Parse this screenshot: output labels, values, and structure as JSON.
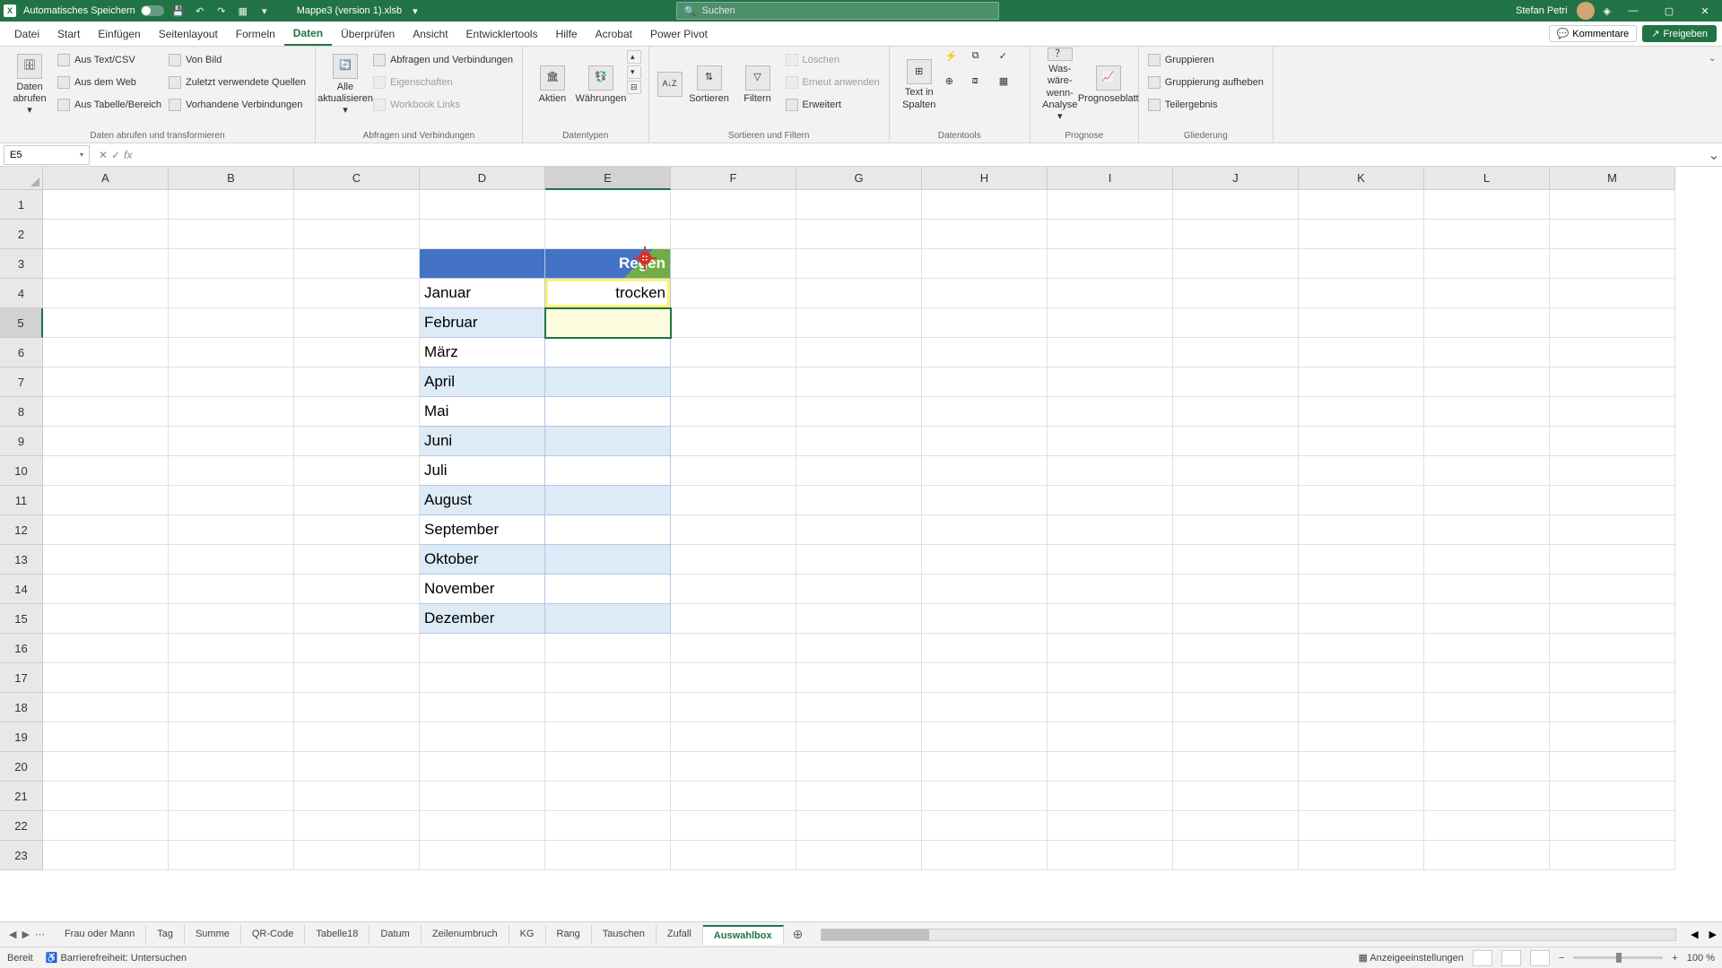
{
  "titlebar": {
    "autosave_label": "Automatisches Speichern",
    "filename": "Mappe3 (version 1).xlsb",
    "search_placeholder": "Suchen",
    "username": "Stefan Petri"
  },
  "ribbon_tabs": [
    "Datei",
    "Start",
    "Einfügen",
    "Seitenlayout",
    "Formeln",
    "Daten",
    "Überprüfen",
    "Ansicht",
    "Entwicklertools",
    "Hilfe",
    "Acrobat",
    "Power Pivot"
  ],
  "ribbon_active_tab": "Daten",
  "ribbon_right": {
    "comments": "Kommentare",
    "share": "Freigeben"
  },
  "ribbon": {
    "group1": {
      "label": "Daten abrufen und transformieren",
      "big": "Daten abrufen",
      "items": [
        "Aus Text/CSV",
        "Aus dem Web",
        "Aus Tabelle/Bereich",
        "Von Bild",
        "Zuletzt verwendete Quellen",
        "Vorhandene Verbindungen"
      ]
    },
    "group2": {
      "label": "Abfragen und Verbindungen",
      "big": "Alle aktualisieren",
      "items": [
        "Abfragen und Verbindungen",
        "Eigenschaften",
        "Workbook Links"
      ]
    },
    "group3": {
      "label": "Datentypen",
      "items": [
        "Aktien",
        "Währungen"
      ]
    },
    "group4": {
      "label": "Sortieren und Filtern",
      "sort": "Sortieren",
      "filter": "Filtern",
      "items": [
        "Löschen",
        "Erneut anwenden",
        "Erweitert"
      ]
    },
    "group5": {
      "label": "Datentools",
      "big": "Text in Spalten"
    },
    "group6": {
      "label": "Prognose",
      "items": [
        "Was-wäre-wenn-Analyse",
        "Prognoseblatt"
      ]
    },
    "group7": {
      "label": "Gliederung",
      "items": [
        "Gruppieren",
        "Gruppierung aufheben",
        "Teilergebnis"
      ]
    }
  },
  "namebox": "E5",
  "formula": "",
  "columns": [
    "A",
    "B",
    "C",
    "D",
    "E",
    "F",
    "G",
    "H",
    "I",
    "J",
    "K",
    "L",
    "M"
  ],
  "selected_col": "E",
  "selected_row": 5,
  "row_count": 23,
  "table": {
    "header": {
      "d": "",
      "e": "Regen"
    },
    "rows": [
      {
        "d": "Januar",
        "e": "trocken"
      },
      {
        "d": "Februar",
        "e": ""
      },
      {
        "d": "März",
        "e": ""
      },
      {
        "d": "April",
        "e": ""
      },
      {
        "d": "Mai",
        "e": ""
      },
      {
        "d": "Juni",
        "e": ""
      },
      {
        "d": "Juli",
        "e": ""
      },
      {
        "d": "August",
        "e": ""
      },
      {
        "d": "September",
        "e": ""
      },
      {
        "d": "Oktober",
        "e": ""
      },
      {
        "d": "November",
        "e": ""
      },
      {
        "d": "Dezember",
        "e": ""
      }
    ]
  },
  "sheet_tabs": [
    "Frau oder Mann",
    "Tag",
    "Summe",
    "QR-Code",
    "Tabelle18",
    "Datum",
    "Zeilenumbruch",
    "KG",
    "Rang",
    "Tauschen",
    "Zufall",
    "Auswahlbox"
  ],
  "active_sheet": "Auswahlbox",
  "statusbar": {
    "ready": "Bereit",
    "accessibility": "Barrierefreiheit: Untersuchen",
    "display_settings": "Anzeigeeinstellungen",
    "zoom": "100 %"
  }
}
